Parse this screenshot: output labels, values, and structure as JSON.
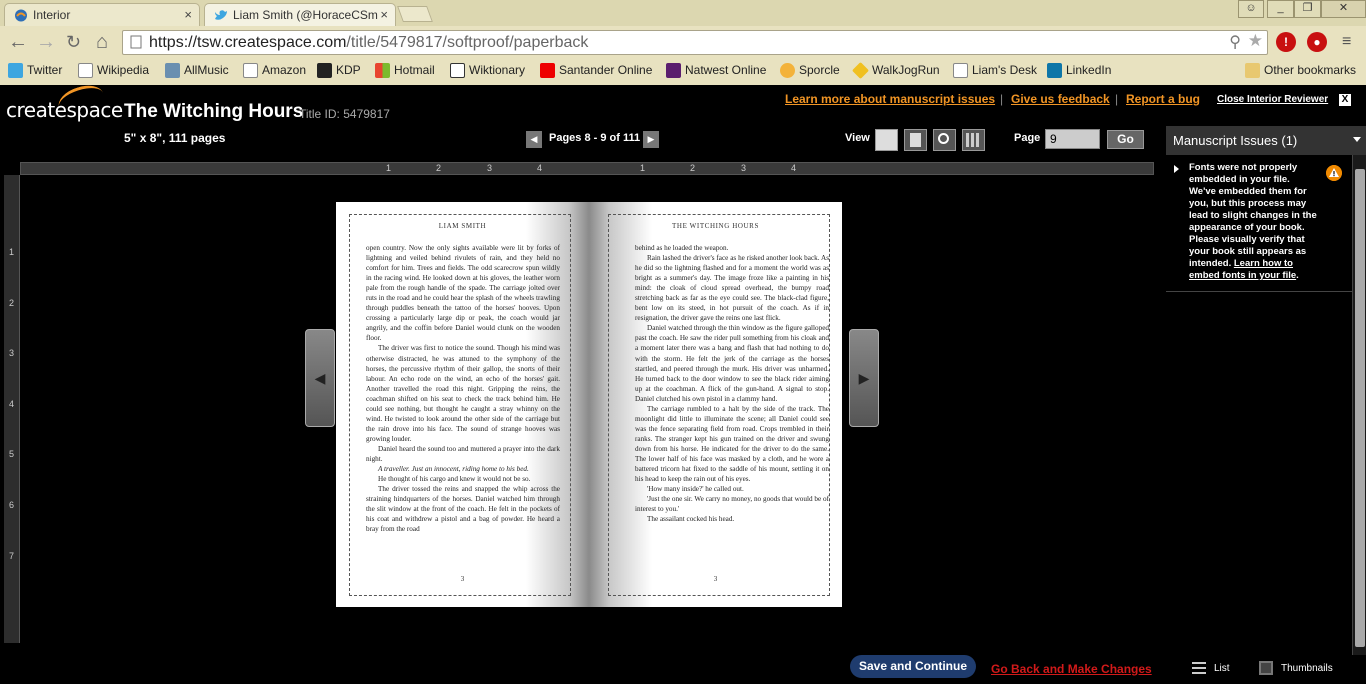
{
  "browser": {
    "tabs": [
      {
        "label": "Interior",
        "close": "×"
      },
      {
        "label": "Liam Smith (@HoraceCSm",
        "close": "×"
      }
    ],
    "url_host": "https://tsw.createspace.com",
    "url_path": "/title/5479817/softproof/paperback",
    "window_controls": {
      "minimize": "_",
      "restore": "❐",
      "close": "✕"
    },
    "bookmarks": [
      "Twitter",
      "Wikipedia",
      "AllMusic",
      "Amazon",
      "KDP",
      "Hotmail",
      "Wiktionary",
      "Santander Online",
      "Natwest Online",
      "Sporcle",
      "WalkJogRun",
      "Liam's Desk",
      "LinkedIn"
    ],
    "other_bookmarks": "Other bookmarks"
  },
  "header": {
    "logo": "createspace",
    "title": "The Witching Hours",
    "title_id": "Title ID: 5479817",
    "size_pages": "5\" x 8\", 111 pages",
    "links": [
      "Learn more about manuscript issues",
      "Give us feedback",
      "Report a bug"
    ],
    "separator": "|",
    "close_reviewer": "Close Interior Reviewer",
    "close_x": "X",
    "pages_label": "Pages 8 - 9 of 111",
    "prev": "◀",
    "next": "▶",
    "view_label": "View",
    "page_label": "Page",
    "page_value": "9",
    "go": "Go"
  },
  "ruler": {
    "h_ticks": [
      "1",
      "2",
      "3",
      "4",
      "1",
      "2",
      "3",
      "4"
    ],
    "v_ticks": [
      "1",
      "2",
      "3",
      "4",
      "5",
      "6",
      "7"
    ]
  },
  "left_page": {
    "running_head": "Liam Smith",
    "folio": "3",
    "paragraphs": [
      {
        "text": "open country. Now the only sights available were lit by forks of lightning and veiled behind rivulets of rain, and they held no comfort for him. Trees and fields. The odd scarecrow spun wildly in the racing wind. He looked down at his gloves, the leather worn pale from the rough handle of the spade. The carriage jolted over ruts in the road and he could hear the splash of the wheels trawling through puddles beneath the tattoo of the horses' hooves. Upon crossing a particularly large dip or peak, the coach would jar angrily, and the coffin before Daniel would clunk on the wooden floor.",
        "style": "noind"
      },
      {
        "text": "The driver was first to notice the sound. Though his mind was otherwise distracted, he was attuned to the symphony of the horses, the percussive rhythm of their gallop, the snorts of their labour. An echo rode on the wind, an echo of the horses' gait. Another travelled the road this night. Gripping the reins, the coachman shifted on his seat to check the track behind him. He could see nothing, but thought he caught a stray whinny on the wind. He twisted to look around the other side of the carriage but the rain drove into his face. The sound of strange hooves was growing louder.",
        "style": ""
      },
      {
        "text": "Daniel heard the sound too and muttered a prayer into the dark night.",
        "style": ""
      },
      {
        "text": "A traveller. Just an innocent, riding home to his bed.",
        "style": "it"
      },
      {
        "text": "He thought of his cargo and knew it would not be so.",
        "style": ""
      },
      {
        "text": "The driver tossed the reins and snapped the whip across the straining hindquarters of the horses. Daniel watched him through the slit window at the front of the coach. He felt in the pockets of his coat and withdrew a pistol and a bag of powder. He heard a bray from the road",
        "style": ""
      }
    ]
  },
  "right_page": {
    "running_head": "The Witching Hours",
    "folio": "3",
    "paragraphs": [
      {
        "text": "behind as he loaded the weapon.",
        "style": "noind"
      },
      {
        "text": "Rain lashed the driver's face as he risked another look back. As he did so the lightning flashed and for a moment the world was as bright as a summer's day. The image froze like a painting in his mind: the cloak of cloud spread overhead, the bumpy road stretching back as far as the eye could see. The black-clad figure, bent low on its steed, in hot pursuit of the coach. As if in resignation, the driver gave the reins one last flick.",
        "style": ""
      },
      {
        "text": "Daniel watched through the thin window as the figure galloped past the coach. He saw the rider pull something from his cloak and a moment later there was a bang and flash that had nothing to do with the storm. He felt the jerk of the carriage as the horses startled, and peered through the murk. His driver was unharmed. He turned back to the door window to see the black rider aiming up at the coachman. A flick of the gun-hand. A signal to stop. Daniel clutched his own pistol in a clammy hand.",
        "style": ""
      },
      {
        "text": "The carriage rumbled to a halt by the side of the track. The moonlight did little to illuminate the scene; all Daniel could see was the fence separating field from road. Crops trembled in their ranks. The stranger kept his gun trained on the driver and swung down from his horse. He indicated for the driver to do the same. The lower half of his face was masked by a cloth, and he wore a battered tricorn hat fixed to the saddle of his mount, settling it on his head to keep the rain out of his eyes.",
        "style": ""
      },
      {
        "text": "'How many inside?' he called out.",
        "style": ""
      },
      {
        "text": "'Just the one sir. We carry no money, no goods that would be of interest to you.'",
        "style": ""
      },
      {
        "text": "The assailant cocked his head.",
        "style": ""
      }
    ]
  },
  "sidebar": {
    "heading": "Manuscript Issues (1)",
    "issue_text": "Fonts were not properly embedded in your file. We've embedded them for you, but this process may lead to slight changes in the appearance of your book. Please visually verify that your book still appears as intended.",
    "issue_link": "Learn how to embed fonts in your file",
    "issue_end": ".",
    "foot_list": "List",
    "foot_thumbnails": "Thumbnails"
  },
  "footer": {
    "save": "Save and Continue",
    "go_back": "Go Back and Make Changes"
  },
  "colors": {
    "accent": "#f19525",
    "save_button": "#1f3c6e",
    "go_back": "#d21a1a",
    "warning": "#f18a00"
  }
}
